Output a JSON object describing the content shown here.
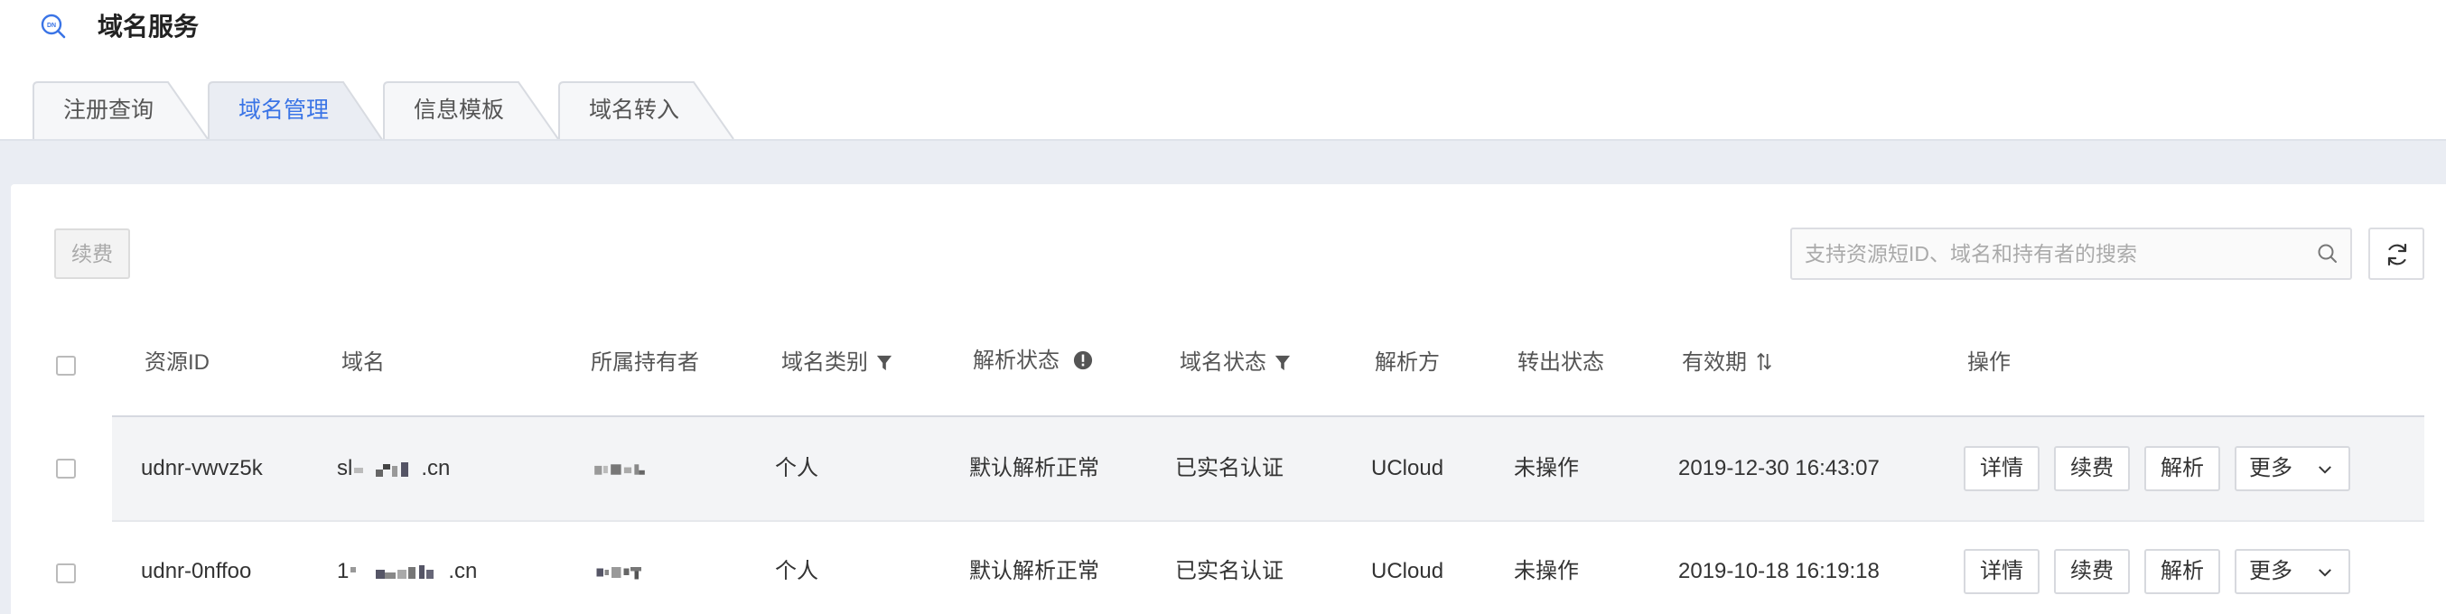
{
  "app": {
    "title": "域名服务",
    "logo_text": "DN"
  },
  "tabs": [
    {
      "label": "注册查询",
      "active": false
    },
    {
      "label": "域名管理",
      "active": true
    },
    {
      "label": "信息模板",
      "active": false
    },
    {
      "label": "域名转入",
      "active": false
    }
  ],
  "toolbar": {
    "renew_label": "续费",
    "search_placeholder": "支持资源短ID、域名和持有者的搜索"
  },
  "table": {
    "headers": {
      "resource_id": "资源ID",
      "domain": "域名",
      "owner": "所属持有者",
      "domain_type": "域名类别",
      "resolve_status": "解析状态",
      "domain_status": "域名状态",
      "resolver": "解析方",
      "transfer_status": "转出状态",
      "expiry": "有效期",
      "actions": "操作"
    },
    "rows": [
      {
        "resource_id": "udnr-vwvz5k",
        "domain_prefix": "sl",
        "domain_suffix": ".cn",
        "domain_type": "个人",
        "resolve_status": "默认解析正常",
        "domain_status": "已实名认证",
        "resolver": "UCloud",
        "transfer_status": "未操作",
        "expiry": "2019-12-30 16:43:07"
      },
      {
        "resource_id": "udnr-0nffoo",
        "domain_prefix": "1",
        "domain_suffix": ".cn",
        "domain_type": "个人",
        "resolve_status": "默认解析正常",
        "domain_status": "已实名认证",
        "resolver": "UCloud",
        "transfer_status": "未操作",
        "expiry": "2019-10-18 16:19:18"
      }
    ],
    "row_actions": {
      "details": "详情",
      "renew": "续费",
      "resolve": "解析",
      "more": "更多"
    }
  },
  "colors": {
    "accent": "#3a74e6",
    "band": "#eaedf3",
    "row_highlight": "#f3f4f6"
  }
}
